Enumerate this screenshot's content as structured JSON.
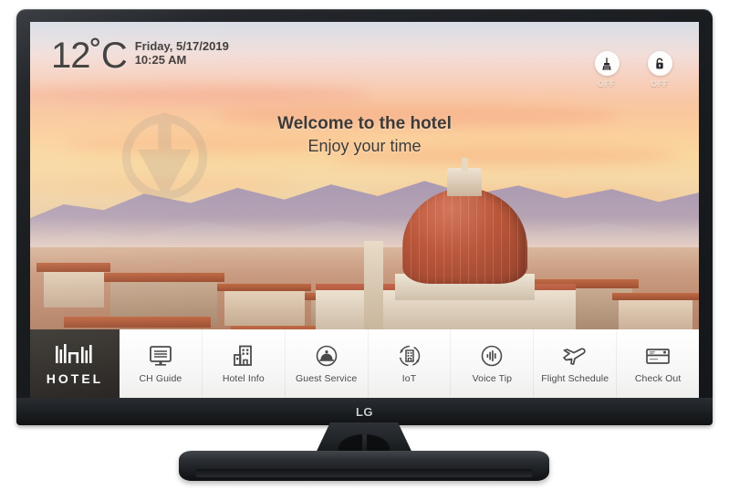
{
  "device": {
    "brand": "LG",
    "type": "hotel-tv"
  },
  "screen": {
    "status_bar": {
      "temperature": "12˚C",
      "date": "Friday, 5/17/2019",
      "time": "10:25 AM",
      "toggles": [
        {
          "name": "make-up-room",
          "icon": "broom-icon",
          "state": "OFF"
        },
        {
          "name": "do-not-disturb",
          "icon": "lock-icon",
          "state": "OFF"
        }
      ]
    },
    "welcome": {
      "line1": "Welcome to the hotel",
      "line2": "Enjoy your time"
    },
    "menu": {
      "logo_label": "HOTEL",
      "items": [
        {
          "label": "CH Guide",
          "icon": "tv-list-icon"
        },
        {
          "label": "Hotel Info",
          "icon": "building-icon"
        },
        {
          "label": "Guest Service",
          "icon": "service-bell-icon"
        },
        {
          "label": "IoT",
          "icon": "iot-building-icon"
        },
        {
          "label": "Voice Tip",
          "icon": "voice-waveform-icon"
        },
        {
          "label": "Flight Schedule",
          "icon": "airplane-icon"
        },
        {
          "label": "Check Out",
          "icon": "credit-card-icon"
        }
      ]
    },
    "background": {
      "scene": "florence-duomo-sunset"
    }
  },
  "colors": {
    "menu_dark": "#302d29",
    "sky_warm": "#f9c79d",
    "dome_terracotta": "#b9563a",
    "text_dark": "#3e3a36"
  }
}
